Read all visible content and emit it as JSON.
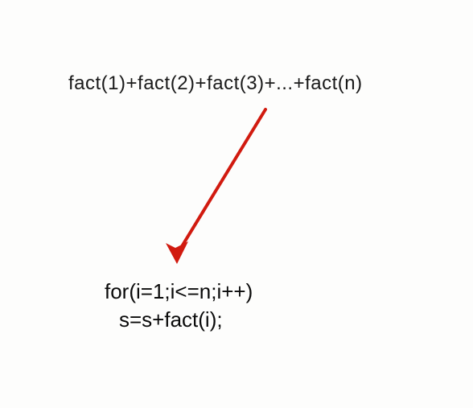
{
  "formula": "fact(1)+fact(2)+fact(3)+...+fact(n)",
  "code": {
    "line1": "for(i=1;i<=n;i++)",
    "line2": "s=s+fact(i);"
  },
  "arrow": {
    "color": "#d11a0f"
  }
}
